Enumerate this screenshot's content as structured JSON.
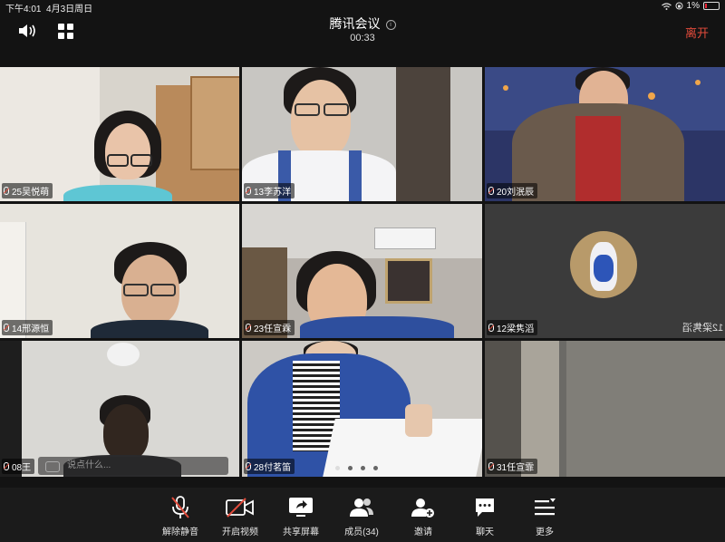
{
  "status": {
    "time": "下午4:01",
    "date": "4月3日周日",
    "battery": "1%"
  },
  "meeting": {
    "title": "腾讯会议",
    "duration": "00:33",
    "leave_label": "离开"
  },
  "participants": [
    {
      "name": "25吴悦萌"
    },
    {
      "name": "13李苏洋"
    },
    {
      "name": "20刘泯辰"
    },
    {
      "name": "14邢源恒"
    },
    {
      "name": "23任宣霖"
    },
    {
      "name": "12梁隽滔",
      "mirrored_tag": "12梁隽滔"
    },
    {
      "name": "08王"
    },
    {
      "name": "28付茗笛"
    },
    {
      "name": "31任宣霏"
    }
  ],
  "chat": {
    "placeholder": "说点什么..."
  },
  "pager": {
    "pages": 4,
    "current": 1
  },
  "toolbar": {
    "unmute": "解除静音",
    "start_video": "开启视频",
    "share_screen": "共享屏幕",
    "members": "成员(34)",
    "invite": "邀请",
    "chat": "聊天",
    "more": "更多"
  },
  "colors": {
    "leave": "#e24b3b",
    "background": "#131313"
  }
}
